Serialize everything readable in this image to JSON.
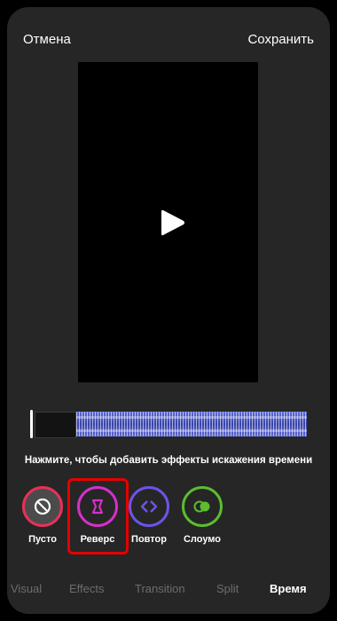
{
  "header": {
    "cancel_label": "Отмена",
    "save_label": "Сохранить"
  },
  "timeline": {
    "hint": "Нажмите, чтобы добавить эффекты искажения времени"
  },
  "effects": [
    {
      "label": "Пусто",
      "icon": "none-icon",
      "color": "#e8315a"
    },
    {
      "label": "Реверс",
      "icon": "reverse-icon",
      "color": "#d531c8"
    },
    {
      "label": "Повтор",
      "icon": "repeat-icon",
      "color": "#6a55e8"
    },
    {
      "label": "Слоумо",
      "icon": "slowmo-icon",
      "color": "#5cbd2e"
    }
  ],
  "selected_effect": "Реверс",
  "tabs": [
    "Visual",
    "Effects",
    "Transition",
    "Split",
    "Время"
  ],
  "active_tab": "Время"
}
